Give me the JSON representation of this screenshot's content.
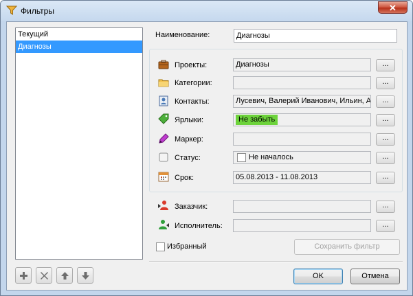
{
  "window": {
    "title": "Фильтры",
    "close_label": "✕"
  },
  "filters_list": {
    "items": [
      {
        "label": "Текущий",
        "selected": false
      },
      {
        "label": "Диагнозы",
        "selected": true
      }
    ]
  },
  "list_toolbar": {
    "icons": [
      "plus-icon",
      "delete-x-icon",
      "arrow-up-icon",
      "arrow-down-icon"
    ]
  },
  "form": {
    "name_label": "Наименование:",
    "name_value": "Диагнозы",
    "projects_label": "Проекты:",
    "projects_value": "Диагнозы",
    "categories_label": "Категории:",
    "categories_value": "",
    "contacts_label": "Контакты:",
    "contacts_value": "Лусевич, Валерий Иванович, Ильин, Ан",
    "tags_label": "Ярлыки:",
    "tags_value": "Не забыть",
    "marker_label": "Маркер:",
    "marker_value": "",
    "status_label": "Статус:",
    "status_value": "Не началось",
    "due_label": "Срок:",
    "due_value": "05.08.2013 - 11.08.2013",
    "customer_label": "Заказчик:",
    "customer_value": "",
    "executor_label": "Исполнитель:",
    "executor_value": "",
    "browse_label": "...",
    "favorite_label": "Избранный",
    "save_filter_label": "Сохранить фильтр"
  },
  "footer": {
    "ok_label": "OK",
    "cancel_label": "Отмена"
  },
  "colors": {
    "selection": "#3399ff",
    "tag_green": "#6dd33b",
    "title_bg": "#c5d8ee",
    "close_red": "#c4412b"
  }
}
